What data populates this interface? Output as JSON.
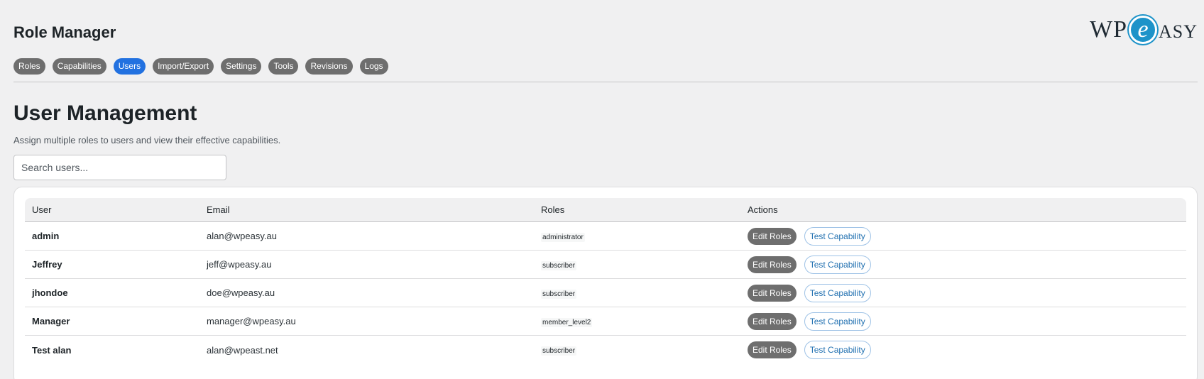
{
  "header": {
    "title": "Role Manager",
    "logo": {
      "part1": "WP",
      "part2": "e",
      "part3": "ASY"
    }
  },
  "tabs": [
    {
      "label": "Roles",
      "active": false
    },
    {
      "label": "Capabilities",
      "active": false
    },
    {
      "label": "Users",
      "active": true
    },
    {
      "label": "Import/Export",
      "active": false
    },
    {
      "label": "Settings",
      "active": false
    },
    {
      "label": "Tools",
      "active": false
    },
    {
      "label": "Revisions",
      "active": false
    },
    {
      "label": "Logs",
      "active": false
    }
  ],
  "section": {
    "title": "User Management",
    "description": "Assign multiple roles to users and view their effective capabilities."
  },
  "search": {
    "placeholder": "Search users...",
    "value": ""
  },
  "table": {
    "columns": [
      "User",
      "Email",
      "Roles",
      "Actions"
    ],
    "rows": [
      {
        "user": "admin",
        "email": "alan@wpeasy.au",
        "role": "administrator"
      },
      {
        "user": "Jeffrey",
        "email": "jeff@wpeasy.au",
        "role": "subscriber"
      },
      {
        "user": "jhondoe",
        "email": "doe@wpeasy.au",
        "role": "subscriber"
      },
      {
        "user": "Manager",
        "email": "manager@wpeasy.au",
        "role": "member_level2"
      },
      {
        "user": "Test alan",
        "email": "alan@wpeast.net",
        "role": "subscriber"
      }
    ],
    "actions": {
      "edit_label": "Edit Roles",
      "test_label": "Test Capability"
    }
  },
  "colors": {
    "tab": "#6e6e6e",
    "tab_active": "#2271e0",
    "logo_accent": "#1d93c9",
    "link": "#2271b1"
  }
}
